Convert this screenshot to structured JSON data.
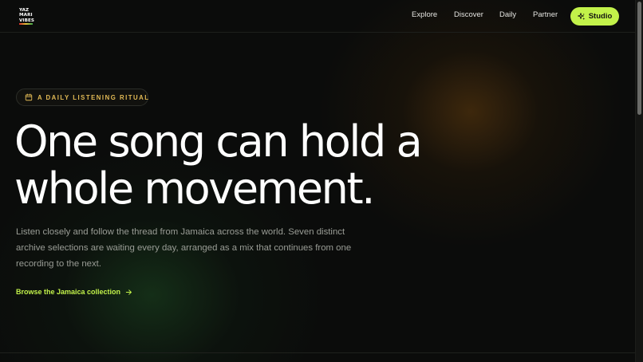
{
  "brand": {
    "logo_lines": [
      "YAZ",
      "MARI",
      "VIBES"
    ],
    "accent": "#c2f24a",
    "logo_colors": [
      "#d62c2c",
      "#e8c33a",
      "#3aa54a"
    ]
  },
  "nav": {
    "items": [
      {
        "label": "Explore"
      },
      {
        "label": "Discover"
      },
      {
        "label": "Daily"
      },
      {
        "label": "Partner"
      }
    ],
    "studio_label": "Studio",
    "studio_icon": "sparkles-icon"
  },
  "hero": {
    "eyebrow": "A DAILY LISTENING RITUAL",
    "eyebrow_icon": "calendar-icon",
    "headline_line1": "One song can hold a",
    "headline_line2": "whole movement.",
    "lede": "Listen closely and follow the thread from Jamaica across the world. Seven distinct archive selections are waiting every day, arranged as a mix that continues from one recording to the next.",
    "cta_label": "Browse the Jamaica collection",
    "cta_icon": "arrow-right-icon"
  }
}
